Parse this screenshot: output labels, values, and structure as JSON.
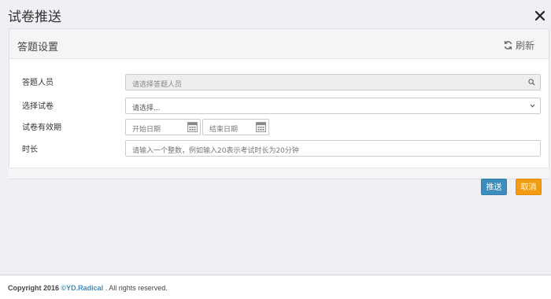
{
  "dialog": {
    "title": "试卷推送"
  },
  "panel": {
    "title": "答题设置",
    "refresh_label": "刷新"
  },
  "form": {
    "respondents": {
      "label": "答题人员",
      "placeholder": "请选择答题人员"
    },
    "exam": {
      "label": "选择试卷",
      "selected": "请选择..."
    },
    "validity": {
      "label": "试卷有效期",
      "start_placeholder": "开始日期",
      "end_placeholder": "结束日期"
    },
    "duration": {
      "label": "时长",
      "placeholder": "请输入一个整数，例如输入20表示考试时长为20分钟"
    }
  },
  "actions": {
    "send_label": "推送",
    "cancel_label": "取消"
  },
  "footer": {
    "prefix": "Copyright 2016 ",
    "brand": "©YD.Radical",
    "suffix": " . All rights reserved."
  },
  "colors": {
    "primary": "#3c8dbc",
    "warning": "#f39c12"
  }
}
